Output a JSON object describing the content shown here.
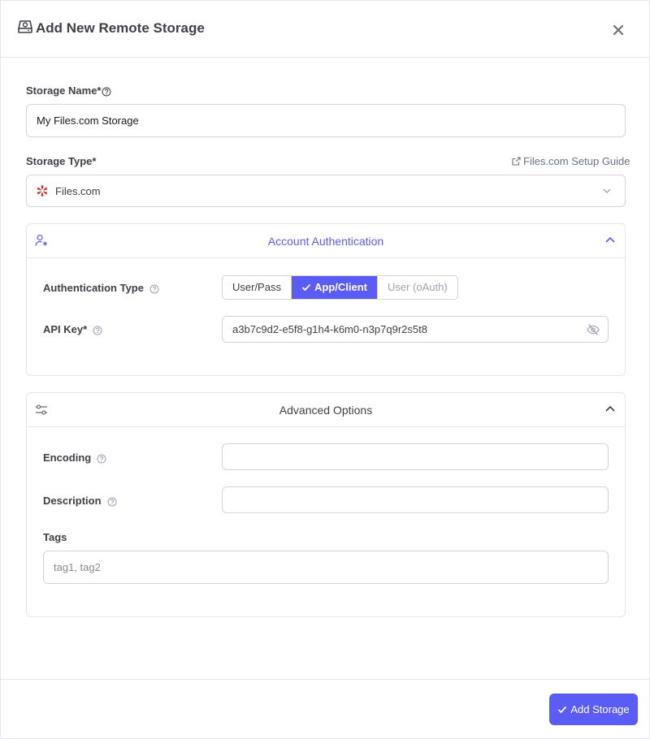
{
  "header": {
    "title": "Add New Remote Storage",
    "title_icon": "hard-drive-icon",
    "close_icon": "close-icon"
  },
  "form": {
    "storage_name": {
      "label": "Storage Name*",
      "value": "My Files.com Storage"
    },
    "storage_type": {
      "label": "Storage Type*",
      "guide_link": "Files.com Setup Guide",
      "selected": "Files.com"
    }
  },
  "auth_panel": {
    "title": "Account Authentication",
    "auth_type_label": "Authentication Type",
    "auth_options": [
      "User/Pass",
      "App/Client",
      "User (oAuth)"
    ],
    "selected_option": "App/Client",
    "api_key_label": "API Key*",
    "api_key_value": "a3b7c9d2-e5f8-g1h4-k6m0-n3p7q9r2s5t8"
  },
  "advanced_panel": {
    "title": "Advanced Options",
    "encoding_label": "Encoding",
    "encoding_value": "",
    "description_label": "Description",
    "description_value": "",
    "tags_label": "Tags",
    "tags_placeholder": "tag1, tag2"
  },
  "footer": {
    "submit_label": "Add Storage"
  },
  "colors": {
    "accent": "#5b5bf5",
    "border": "#d4d4d8",
    "brand_red": "#dc2626"
  }
}
